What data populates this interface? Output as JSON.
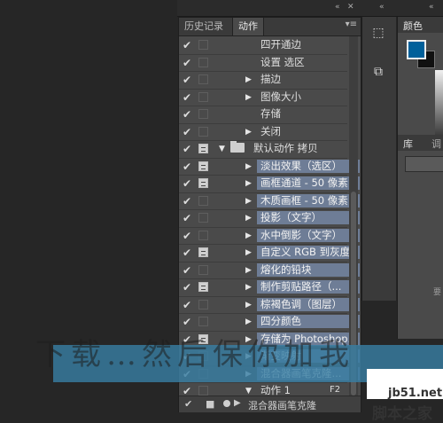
{
  "top_bar": {
    "collapse": "«",
    "expand": "»"
  },
  "actions_panel": {
    "tabs": [
      "历史记录",
      "动作"
    ],
    "menu_icon": "panel-menu-icon",
    "rows": [
      {
        "check": "✔",
        "dialog": false,
        "indent": 1,
        "expand": "",
        "label": "四开通边",
        "hl": false,
        "folder": false
      },
      {
        "check": "✔",
        "dialog": false,
        "indent": 1,
        "expand": "",
        "label": "设置 选区",
        "hl": false,
        "folder": false
      },
      {
        "check": "✔",
        "dialog": false,
        "indent": 1,
        "expand": "▶",
        "label": "描边",
        "hl": false,
        "folder": false
      },
      {
        "check": "✔",
        "dialog": false,
        "indent": 1,
        "expand": "▶",
        "label": "图像大小",
        "hl": false,
        "folder": false
      },
      {
        "check": "✔",
        "dialog": false,
        "indent": 1,
        "expand": "",
        "label": "存储",
        "hl": false,
        "folder": false
      },
      {
        "check": "✔",
        "dialog": false,
        "indent": 1,
        "expand": "▶",
        "label": "关闭",
        "hl": false,
        "folder": false
      },
      {
        "check": "✔",
        "dialog": true,
        "indent": 0,
        "expand": "▼",
        "label": "默认动作 拷贝",
        "hl": false,
        "folder": true
      },
      {
        "check": "✔",
        "dialog": true,
        "indent": 1,
        "expand": "▶",
        "label": "淡出效果（选区）",
        "hl": true,
        "folder": false
      },
      {
        "check": "✔",
        "dialog": true,
        "indent": 1,
        "expand": "▶",
        "label": "画框通道 - 50 像素",
        "hl": true,
        "folder": false
      },
      {
        "check": "✔",
        "dialog": false,
        "indent": 1,
        "expand": "▶",
        "label": "木质画框 - 50 像素",
        "hl": true,
        "folder": false
      },
      {
        "check": "✔",
        "dialog": false,
        "indent": 1,
        "expand": "▶",
        "label": "投影（文字）",
        "hl": true,
        "folder": false
      },
      {
        "check": "✔",
        "dialog": false,
        "indent": 1,
        "expand": "▶",
        "label": "水中倒影（文字）",
        "hl": true,
        "folder": false
      },
      {
        "check": "✔",
        "dialog": true,
        "indent": 1,
        "expand": "▶",
        "label": "自定义 RGB 到灰度",
        "hl": true,
        "folder": false
      },
      {
        "check": "✔",
        "dialog": false,
        "indent": 1,
        "expand": "▶",
        "label": "熔化的铅块",
        "hl": true,
        "folder": false
      },
      {
        "check": "✔",
        "dialog": true,
        "indent": 1,
        "expand": "▶",
        "label": "制作剪贴路径（...",
        "hl": true,
        "folder": false
      },
      {
        "check": "✔",
        "dialog": false,
        "indent": 1,
        "expand": "▶",
        "label": "棕褐色调（图层）",
        "hl": true,
        "folder": false
      },
      {
        "check": "✔",
        "dialog": false,
        "indent": 1,
        "expand": "▶",
        "label": "四分颜色",
        "hl": true,
        "folder": false
      },
      {
        "check": "✔",
        "dialog": true,
        "indent": 1,
        "expand": "▶",
        "label": "存储为 Photoshop...",
        "hl": true,
        "folder": false
      },
      {
        "check": "✔",
        "dialog": false,
        "indent": 1,
        "expand": "▶",
        "label": "渐变映射",
        "hl": true,
        "folder": false
      },
      {
        "check": "✔",
        "dialog": false,
        "indent": 1,
        "expand": "▶",
        "label": "混合器画笔克隆...",
        "hl": true,
        "folder": false
      },
      {
        "check": "✔",
        "dialog": false,
        "indent": 1,
        "expand": "▼",
        "label": "动作 1",
        "hl": false,
        "folder": false
      }
    ],
    "action_shortcut": "F2",
    "bottom_label": "混合器画笔克隆"
  },
  "color_panel": {
    "tab": "颜色",
    "fg_color": "#00609a",
    "bg_color": "#111111"
  },
  "library_panel": {
    "tab1": "库",
    "tab2": "调",
    "side_text": "要"
  },
  "watermark": {
    "text": "下载…然后保你加我",
    "site": "jb51.net",
    "site_cn": "脚本之家",
    "bar_color": "#387ea2"
  }
}
